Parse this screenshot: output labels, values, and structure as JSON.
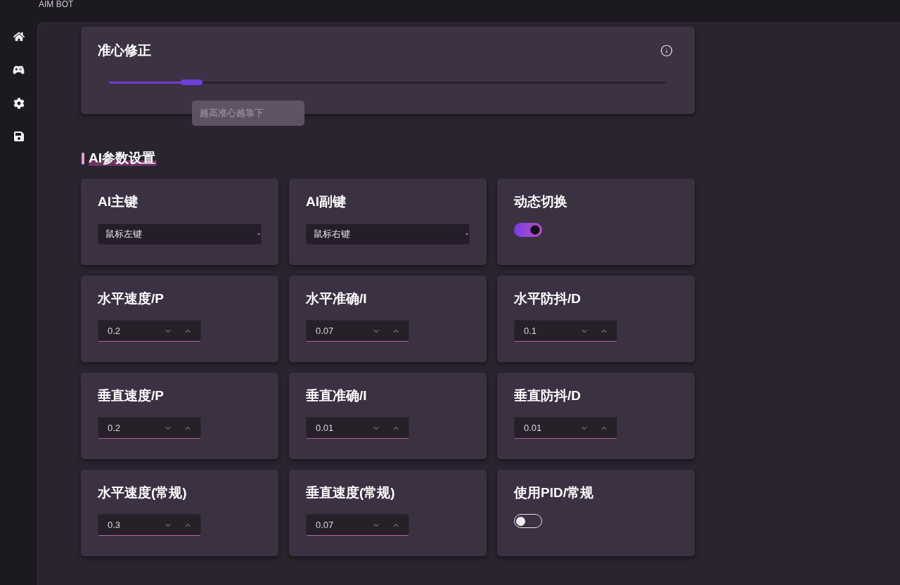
{
  "app": {
    "title": "AIM BOT"
  },
  "aim_correction": {
    "title": "准心修正",
    "level": 0.168,
    "tooltip": "越高准心越靠下"
  },
  "section": {
    "title": "AI参数设置"
  },
  "settings": [
    {
      "kind": "select",
      "title": "AI主键",
      "value": "鼠标左键"
    },
    {
      "kind": "select",
      "title": "AI副键",
      "value": "鼠标右键"
    },
    {
      "kind": "toggle",
      "title": "动态切换",
      "on": true
    },
    {
      "kind": "number",
      "title": "水平速度/P",
      "value": "0.2"
    },
    {
      "kind": "number",
      "title": "水平准确/I",
      "value": "0.07"
    },
    {
      "kind": "number",
      "title": "水平防抖/D",
      "value": "0.1"
    },
    {
      "kind": "number",
      "title": "垂直速度/P",
      "value": "0.2"
    },
    {
      "kind": "number",
      "title": "垂直准确/I",
      "value": "0.01"
    },
    {
      "kind": "number",
      "title": "垂直防抖/D",
      "value": "0.01"
    },
    {
      "kind": "number",
      "title": "水平速度(常规)",
      "value": "0.3"
    },
    {
      "kind": "number",
      "title": "垂直速度(常规)",
      "value": "0.07"
    },
    {
      "kind": "toggle",
      "title": "使用PID/常规",
      "on": false
    }
  ]
}
